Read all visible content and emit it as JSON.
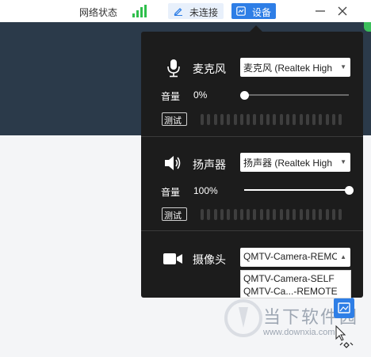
{
  "titlebar": {
    "network_label": "网络状态",
    "connection_label": "未连接",
    "settings_label": "设备",
    "icons": [
      "signal-icon",
      "edit-icon",
      "settings-icon",
      "minimize-icon",
      "close-icon"
    ],
    "signal_color": "#2fbf4b",
    "accent": "#2e7ee6"
  },
  "panel": {
    "background": "#1c1c1c",
    "microphone": {
      "label": "麦克风",
      "select_value": "麦克风 (Realtek High",
      "volume_label": "音量",
      "volume_value": "0%",
      "volume_level": 0,
      "test_label": "测试"
    },
    "speaker": {
      "label": "扬声器",
      "select_value": "扬声器 (Realtek High",
      "volume_label": "音量",
      "volume_value": "100%",
      "volume_level": 1,
      "test_label": "测试"
    },
    "camera": {
      "label": "摄像头",
      "select_value": "QMTV-Camera-REMOTE",
      "options": [
        "QMTV-Camera-SELF",
        "QMTV-Ca...-REMOTE"
      ]
    }
  },
  "watermark": {
    "text": "当下软件园",
    "url": "www.downxia.com"
  }
}
